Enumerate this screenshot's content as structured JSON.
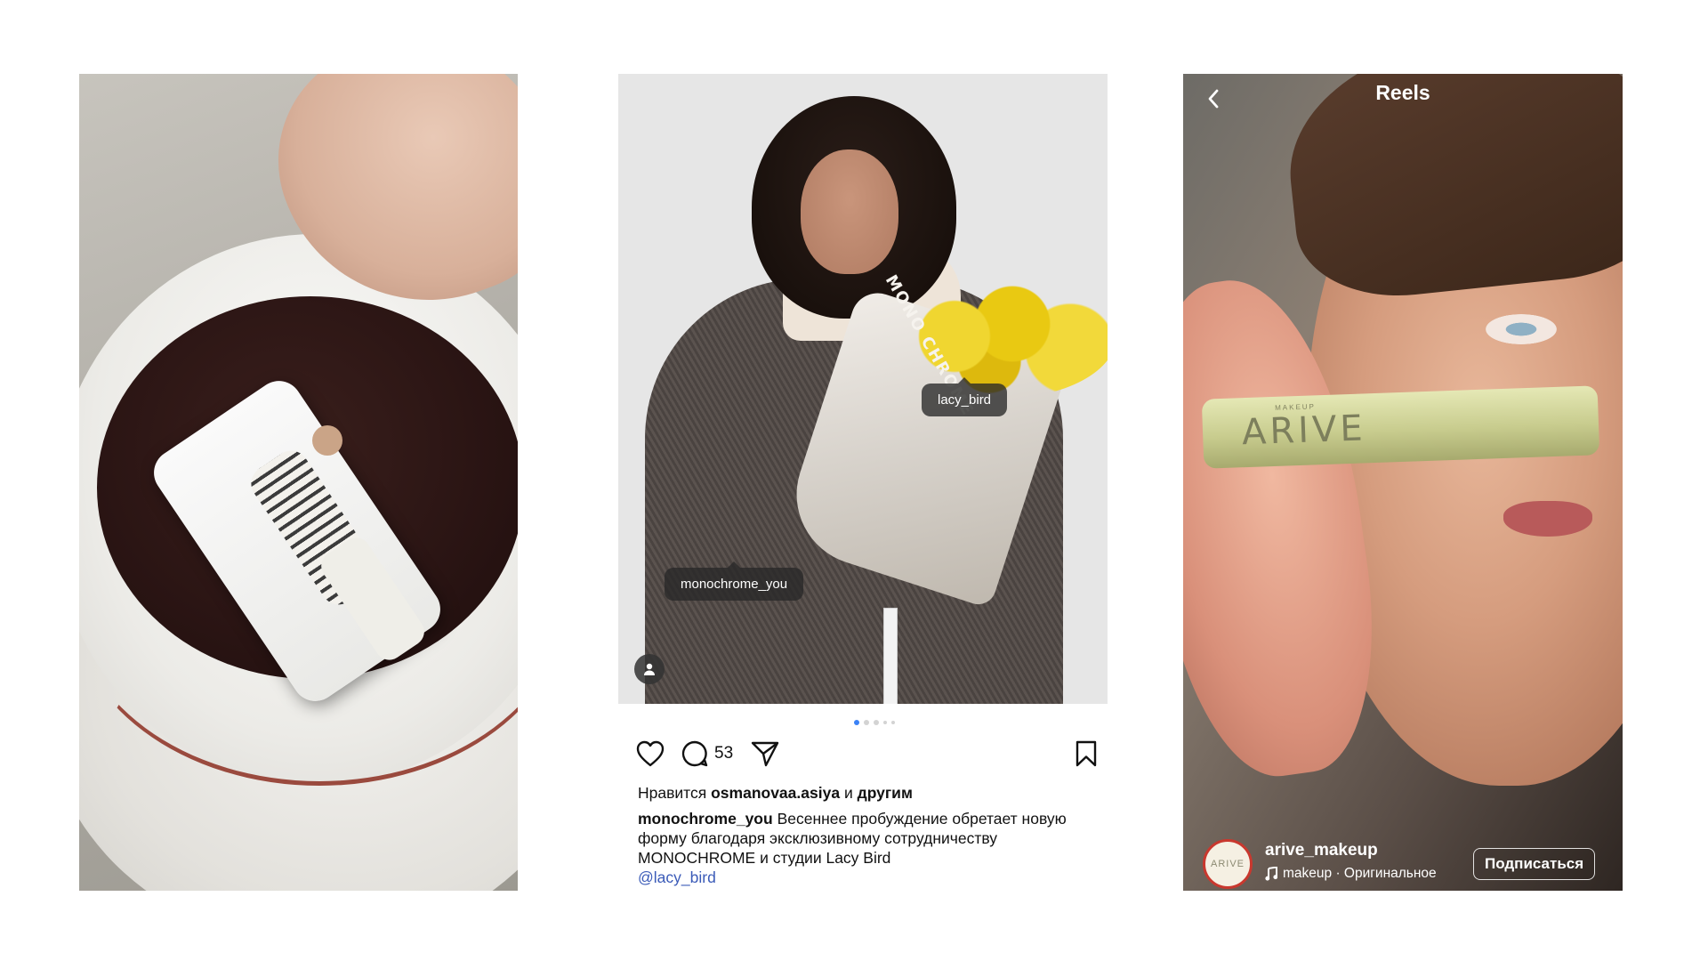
{
  "post": {
    "photo_tags": {
      "tag_1": "lacy_bird",
      "tag_2": "monochrome_you"
    },
    "photo_brand_print": "MONO CHROME",
    "carousel": {
      "current": 1,
      "total": 5
    },
    "comment_count": "53",
    "likes": {
      "prefix": "Нравится",
      "user": "osmanovaa.asiya",
      "conj": "и",
      "others": "другим"
    },
    "caption": {
      "author": "monochrome_you",
      "text": "Весеннее пробуждение обретает новую форму благодаря эксклюзивному сотрудничеству MONOCHROME и студии Lacy Bird",
      "mention": "@lacy_bird"
    }
  },
  "reels": {
    "title": "Reels",
    "product_brand": "ARIVE",
    "product_small": "MAKEUP",
    "avatar_text": "ARIVE",
    "username": "arive_makeup",
    "audio": "makeup · Оригинальное",
    "follow_label": "Подписаться"
  },
  "colors": {
    "link": "#3b5bb8",
    "carousel_active": "#3b82f6",
    "reels_avatar_ring": "#c9382e"
  },
  "icons": [
    "heart-icon",
    "comment-icon",
    "share-icon",
    "bookmark-icon",
    "user-tags-icon",
    "back-chevron-icon",
    "music-note-icon"
  ]
}
